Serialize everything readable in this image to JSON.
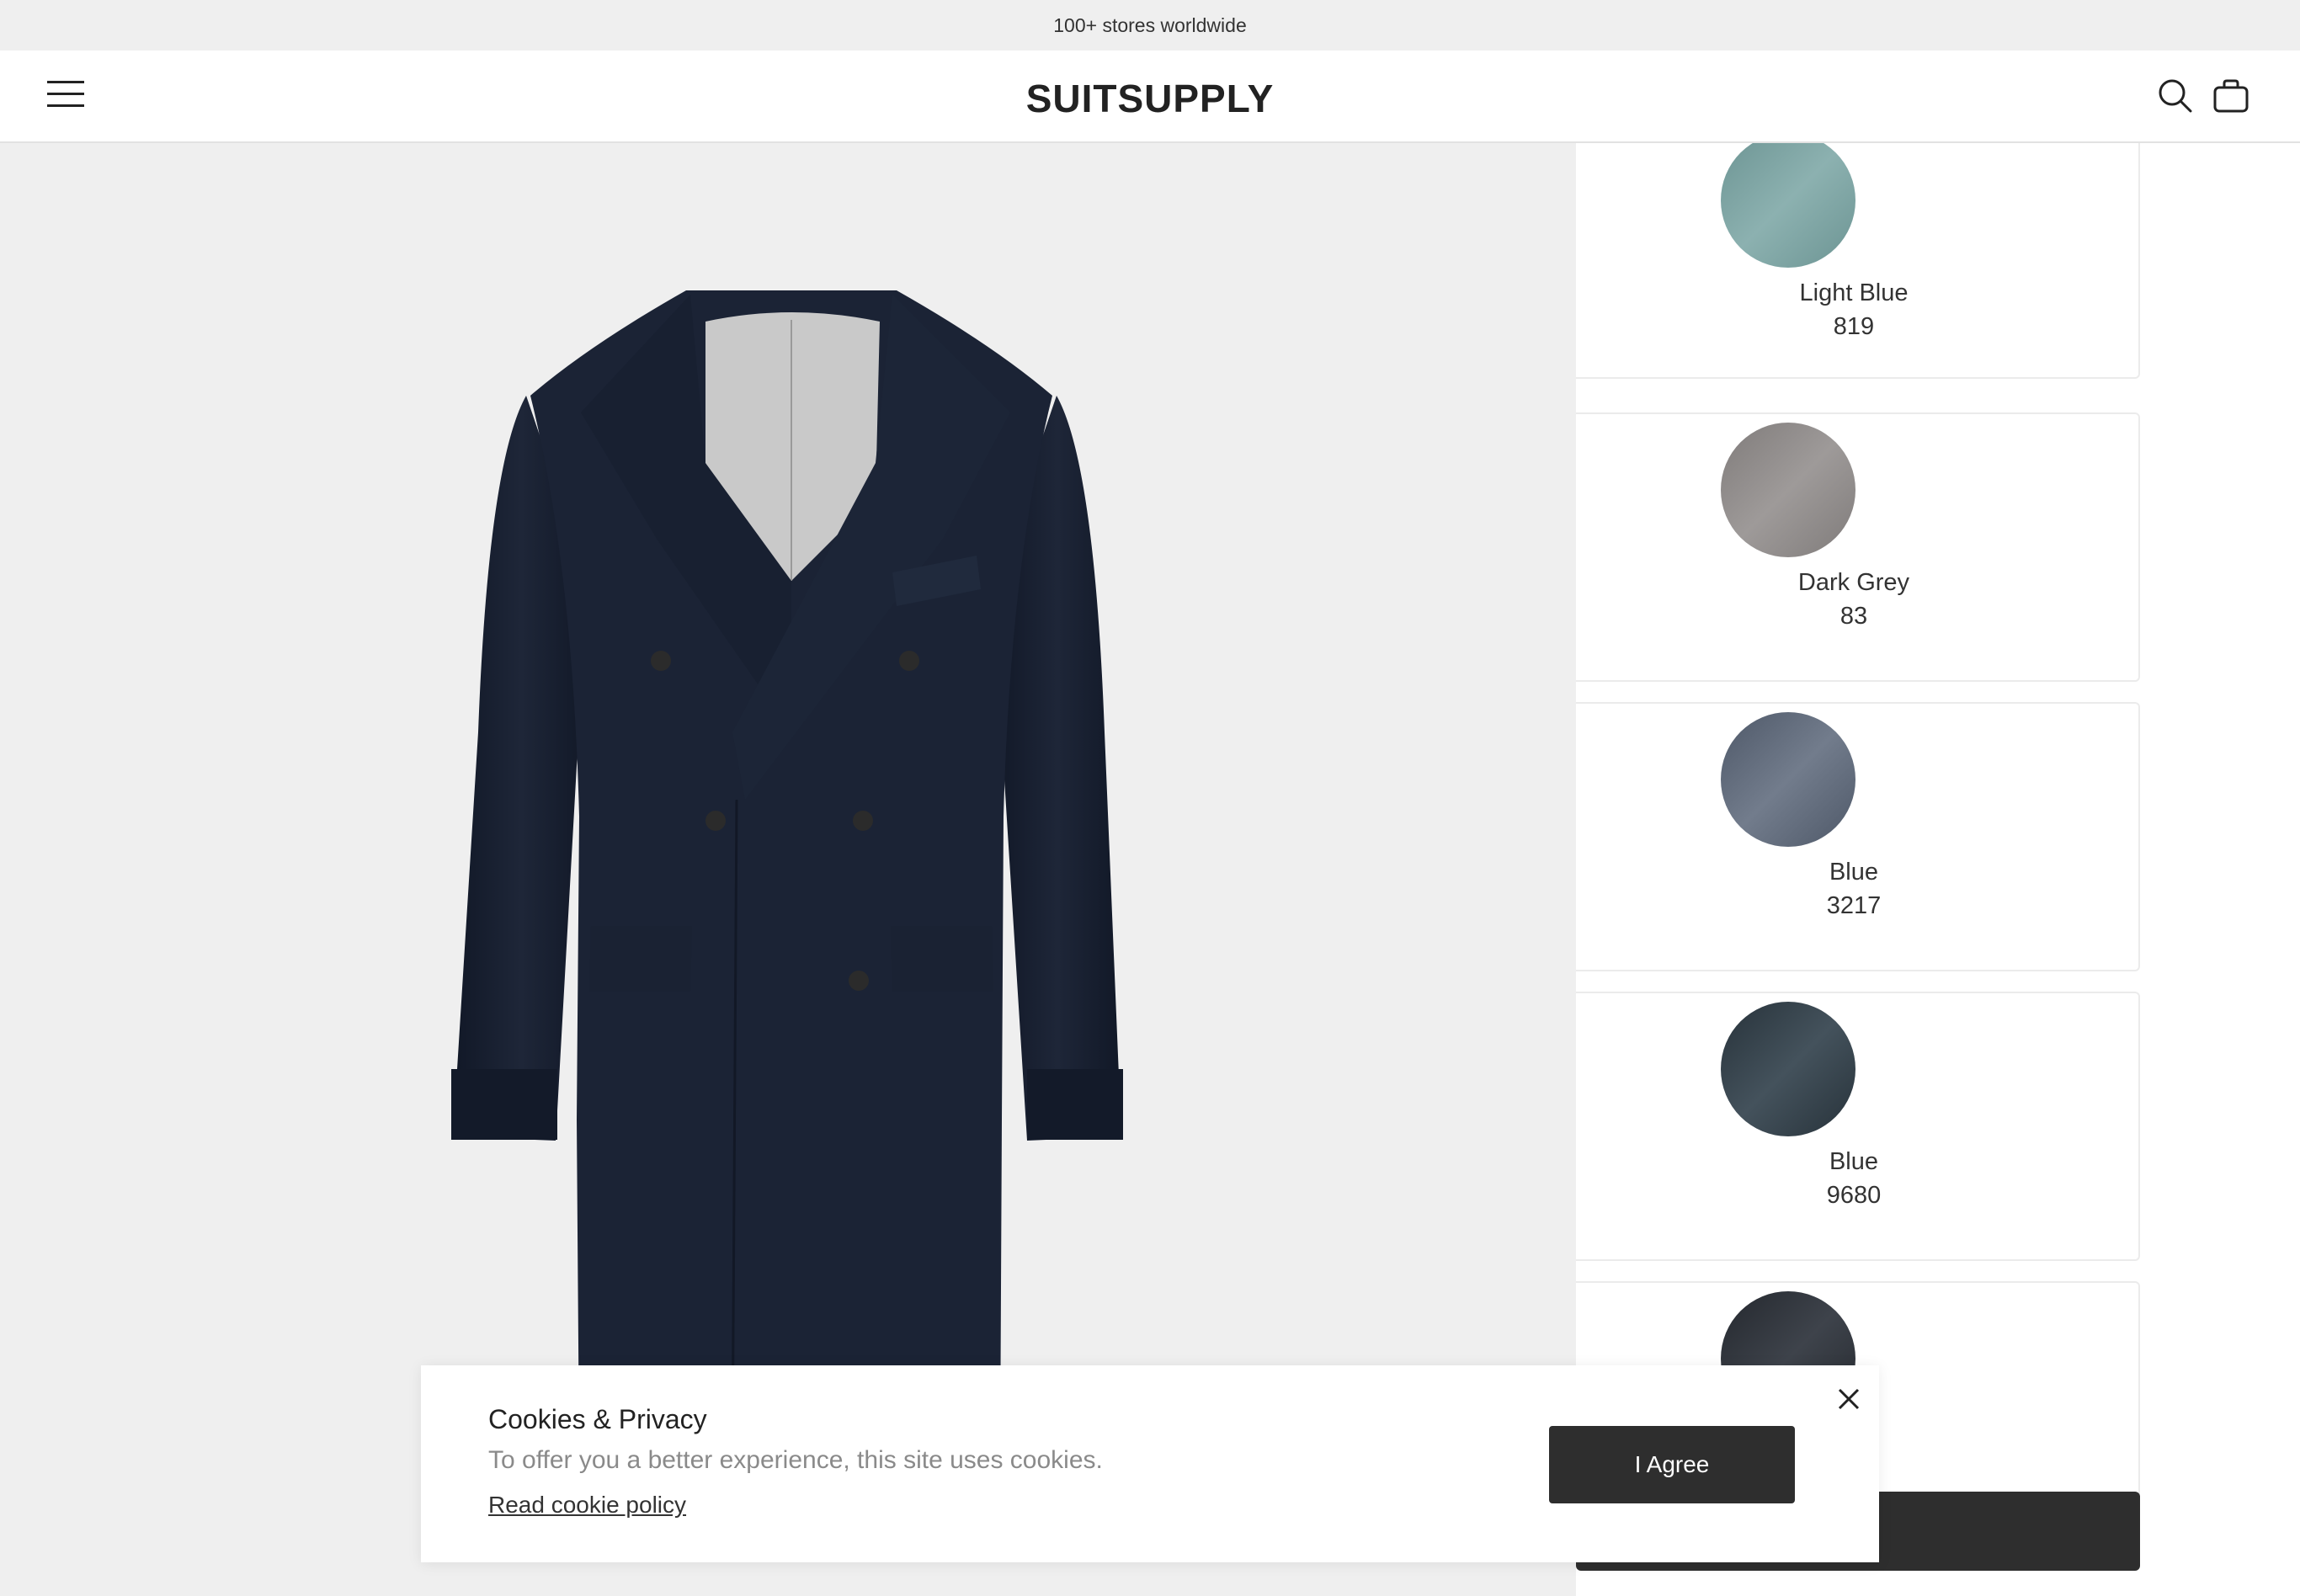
{
  "announcement": "100+ stores worldwide",
  "header": {
    "logo": "SUITSUPPLY",
    "icons": [
      "hamburger-menu-icon",
      "search-icon",
      "shopping-bag-icon"
    ]
  },
  "product": {
    "color": "#1b2335"
  },
  "color_panel": {
    "close_icon": "close-icon",
    "swatches": [
      {
        "name": "Light Blue",
        "code": "819",
        "color": "#7fa3a2"
      },
      {
        "name": "Dark Grey",
        "code": "83",
        "color": "#8c8988"
      },
      {
        "name": "Blue",
        "code": "3217",
        "color": "#5a6474"
      },
      {
        "name": "Blue",
        "code": "9680",
        "color": "#2f3a42"
      },
      {
        "name": "",
        "code": "",
        "color": "#2c3037"
      }
    ]
  },
  "cookie_banner": {
    "title": "Cookies & Privacy",
    "text": "To offer you a better experience, this site uses cookies.",
    "link": "Read cookie policy",
    "agree_label": "I Agree",
    "close_icon": "close-icon"
  },
  "colors": {
    "dark_button": "#2e2e2e",
    "background": "#efefef"
  }
}
